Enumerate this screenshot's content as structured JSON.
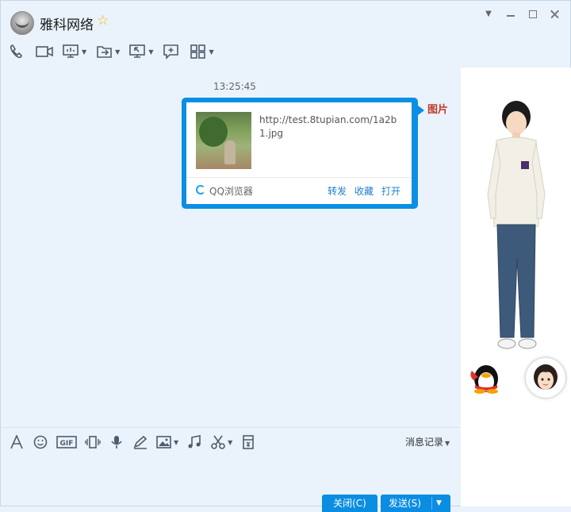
{
  "title": {
    "contact_name": "雅科网络"
  },
  "chat": {
    "timestamp": "13:25:45",
    "card": {
      "url": "http://test.8tupian.com/1a2b1.jpg",
      "app_label": "QQ浏览器",
      "actions": {
        "forward": "转发",
        "favorite": "收藏",
        "open": "打开"
      }
    },
    "stamp": "图片"
  },
  "input": {
    "history_label": "消息记录"
  },
  "buttons": {
    "close": "关闭(C)",
    "send": "发送(S)"
  },
  "colors": {
    "accent": "#0b8de1",
    "background": "#eaf2fb",
    "link": "#1e7fd0"
  },
  "icons": {
    "toolbar": [
      "phone-icon",
      "video-icon",
      "screen-share-icon",
      "file-transfer-icon",
      "remote-desktop-icon",
      "message-icon",
      "apps-icon"
    ],
    "input": [
      "font-icon",
      "emoji-icon",
      "gif-icon",
      "shake-icon",
      "voice-icon",
      "draw-icon",
      "image-icon",
      "music-icon",
      "scissors-icon",
      "red-packet-icon"
    ]
  }
}
